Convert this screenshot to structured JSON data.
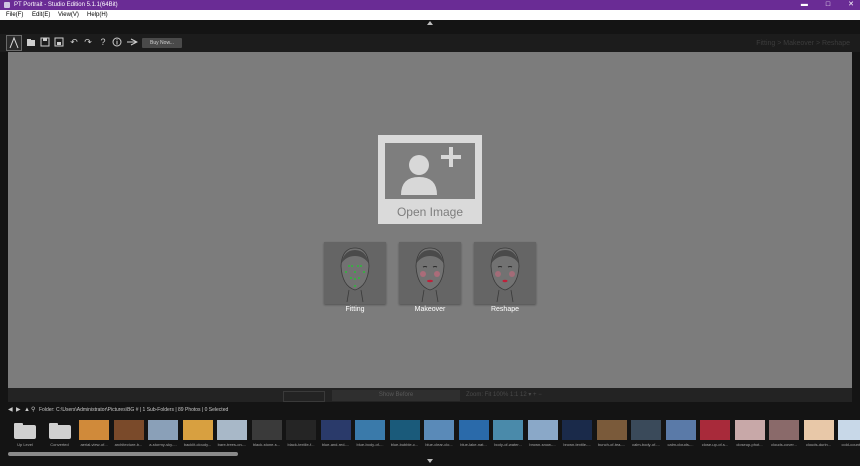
{
  "window": {
    "title": "PT Portrait - Studio Edition 5.1.1(64Bit)",
    "buttons": {
      "minimize": "▬",
      "maximize": "□",
      "close": "✕"
    }
  },
  "menu": [
    "File(F)",
    "Edit(E)",
    "View(V)",
    "Help(H)"
  ],
  "toolbar": {
    "buy_now": "Buy Now...",
    "icons": [
      "app-logo-icon",
      "folder-open-icon",
      "save-icon",
      "save-as-icon",
      "undo-icon",
      "redo-icon",
      "help-icon",
      "info-icon",
      "feather-icon"
    ]
  },
  "breadcrumb": "Fitting > Makeover > Reshape",
  "canvas": {
    "open_image_label": "Open Image",
    "modes": [
      {
        "label": "Fitting"
      },
      {
        "label": "Makeover"
      },
      {
        "label": "Reshape"
      }
    ]
  },
  "compare_bar": {
    "show_before": "Show Before",
    "zoom_text": "Zoom: Fit  100%  1:1  12 ▾  +  −"
  },
  "path_bar": {
    "text": "Folder: C:\\Users\\Administrator\\Pictures\\BG # | 1 Sub-Folders | 89 Photos | 0 Selected"
  },
  "filmstrip": [
    {
      "caption": "Up Level",
      "kind": "folder"
    },
    {
      "caption": "Converted",
      "kind": "folder"
    },
    {
      "caption": "aerial-view-of...",
      "color": "#d08a3a"
    },
    {
      "caption": "architecture-b...",
      "color": "#7a4a2a"
    },
    {
      "caption": "a-stormy-sky-...",
      "color": "#8aa0b8"
    },
    {
      "caption": "backlit-cloudy...",
      "color": "#d8a040"
    },
    {
      "caption": "bare-trees-on-...",
      "color": "#a8b8c8"
    },
    {
      "caption": "black-stone-s...",
      "color": "#3a3a3a"
    },
    {
      "caption": "black-textile-f...",
      "color": "#252525"
    },
    {
      "caption": "blue-and-red-...",
      "color": "#2a3a6a"
    },
    {
      "caption": "blue-body-of-...",
      "color": "#3a7aaa"
    },
    {
      "caption": "blue-bubble-c...",
      "color": "#1a5a7a"
    },
    {
      "caption": "blue-clear-clo...",
      "color": "#5a8ab8"
    },
    {
      "caption": "blue-lake-nat...",
      "color": "#2a6aaa"
    },
    {
      "caption": "body-of-water...",
      "color": "#4a8aaa"
    },
    {
      "caption": "brown-snow-...",
      "color": "#8aa8c8"
    },
    {
      "caption": "brown-textile-...",
      "color": "#1a2a4a"
    },
    {
      "caption": "bunch-of-tea-...",
      "color": "#7a5a3a"
    },
    {
      "caption": "calm-body-of-...",
      "color": "#3a4a5a"
    },
    {
      "caption": "calm-clouds-...",
      "color": "#5a7aa8"
    },
    {
      "caption": "close-up-of-s...",
      "color": "#a82a3a"
    },
    {
      "caption": "closeup-phot...",
      "color": "#c8a8a8"
    },
    {
      "caption": "clouds-cover...",
      "color": "#8a6a6a"
    },
    {
      "caption": "clouds-durin...",
      "color": "#e8c8a8"
    },
    {
      "caption": "cold-countr...",
      "color": "#c8d8e8"
    }
  ]
}
